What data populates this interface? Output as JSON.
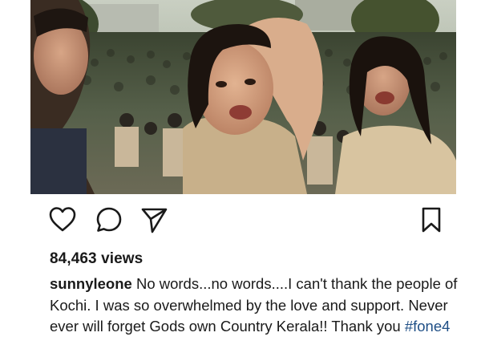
{
  "post": {
    "media": {
      "kind": "video-still",
      "description_icon": "photo"
    },
    "actions": {
      "like_icon": "heart-icon",
      "comment_icon": "comment-icon",
      "share_icon": "send-icon",
      "save_icon": "bookmark-icon"
    },
    "views": "84,463 views",
    "caption": {
      "username": "sunnyleone",
      "text": " No words...no words....I can't thank the people of Kochi. I was so overwhelmed by the love and support. Never ever will forget Gods own Country Kerala!! Thank you ",
      "hashtag": "#fone4"
    }
  },
  "colors": {
    "text": "#1a1a1a",
    "hashtag": "#1f4f86",
    "background": "#ffffff"
  }
}
